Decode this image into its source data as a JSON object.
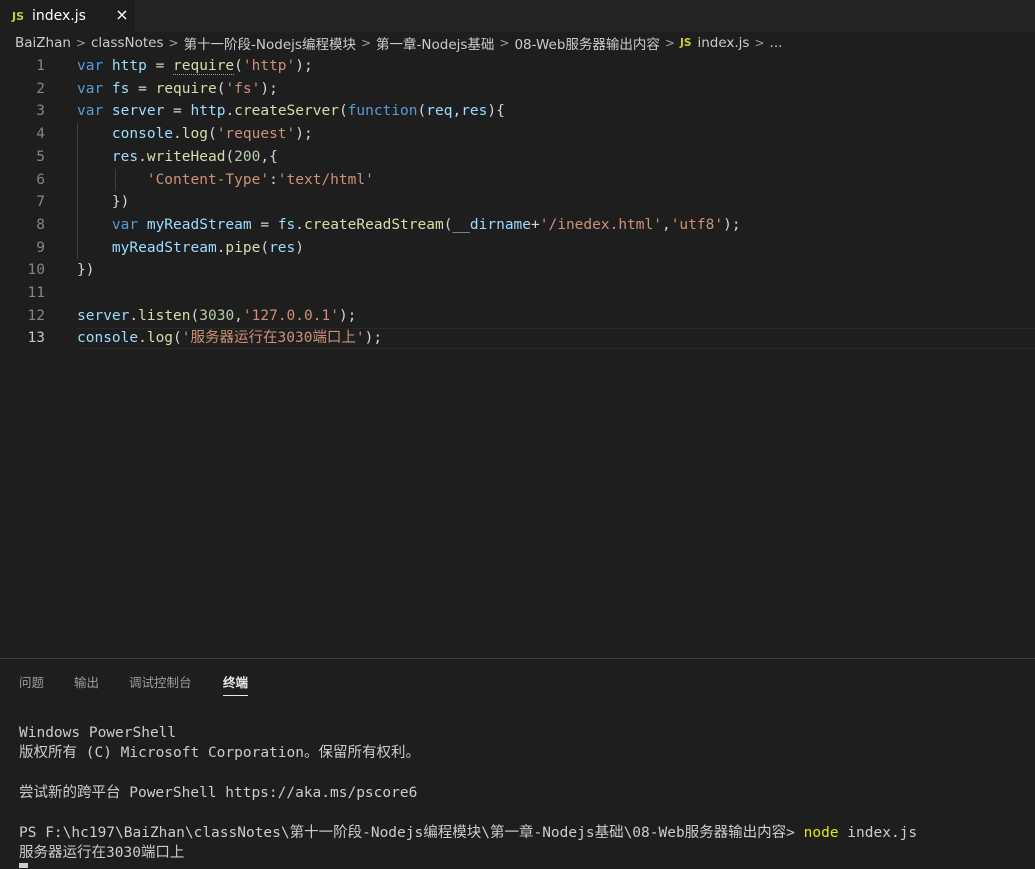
{
  "tab": {
    "badge": "JS",
    "label": "index.js",
    "close": "×"
  },
  "breadcrumb": {
    "items": [
      "BaiZhan",
      "classNotes",
      "第十一阶段-Nodejs编程模块",
      "第一章-Nodejs基础",
      "08-Web服务器输出内容"
    ],
    "file_badge": "JS",
    "file": "index.js",
    "more": "..."
  },
  "editor": {
    "lines": [
      {
        "n": "1",
        "t": [
          [
            "kw",
            "var "
          ],
          [
            "var",
            "http"
          ],
          [
            "punc",
            " = "
          ],
          [
            "fn sq",
            "require"
          ],
          [
            "punc",
            "("
          ],
          [
            "str",
            "'http'"
          ],
          [
            "punc",
            ");"
          ]
        ]
      },
      {
        "n": "2",
        "t": [
          [
            "kw",
            "var "
          ],
          [
            "var",
            "fs"
          ],
          [
            "punc",
            " = "
          ],
          [
            "fn",
            "require"
          ],
          [
            "punc",
            "("
          ],
          [
            "str",
            "'fs'"
          ],
          [
            "punc",
            ");"
          ]
        ]
      },
      {
        "n": "3",
        "t": [
          [
            "kw",
            "var "
          ],
          [
            "var",
            "server"
          ],
          [
            "punc",
            " = "
          ],
          [
            "var",
            "http"
          ],
          [
            "punc",
            "."
          ],
          [
            "fn",
            "createServer"
          ],
          [
            "punc",
            "("
          ],
          [
            "kw",
            "function"
          ],
          [
            "punc",
            "("
          ],
          [
            "var",
            "req"
          ],
          [
            "punc",
            ","
          ],
          [
            "var",
            "res"
          ],
          [
            "punc",
            "){"
          ]
        ]
      },
      {
        "n": "4",
        "t": [
          [
            "punc",
            "    "
          ],
          [
            "var",
            "console"
          ],
          [
            "punc",
            "."
          ],
          [
            "fn",
            "log"
          ],
          [
            "punc",
            "("
          ],
          [
            "str",
            "'request'"
          ],
          [
            "punc",
            ");"
          ]
        ]
      },
      {
        "n": "5",
        "t": [
          [
            "punc",
            "    "
          ],
          [
            "var",
            "res"
          ],
          [
            "punc",
            "."
          ],
          [
            "fn",
            "writeHead"
          ],
          [
            "punc",
            "("
          ],
          [
            "num",
            "200"
          ],
          [
            "punc",
            ",{"
          ]
        ]
      },
      {
        "n": "6",
        "t": [
          [
            "punc",
            "        "
          ],
          [
            "str",
            "'Content-Type'"
          ],
          [
            "punc",
            ":"
          ],
          [
            "str",
            "'text/html'"
          ]
        ]
      },
      {
        "n": "7",
        "t": [
          [
            "punc",
            "    })"
          ]
        ]
      },
      {
        "n": "8",
        "t": [
          [
            "punc",
            "    "
          ],
          [
            "kw",
            "var "
          ],
          [
            "var",
            "myReadStream"
          ],
          [
            "punc",
            " = "
          ],
          [
            "var",
            "fs"
          ],
          [
            "punc",
            "."
          ],
          [
            "fn",
            "createReadStream"
          ],
          [
            "punc",
            "("
          ],
          [
            "var",
            "__dirname"
          ],
          [
            "punc",
            "+"
          ],
          [
            "str",
            "'/inedex.html'"
          ],
          [
            "punc",
            ","
          ],
          [
            "str",
            "'utf8'"
          ],
          [
            "punc",
            ");"
          ]
        ]
      },
      {
        "n": "9",
        "t": [
          [
            "punc",
            "    "
          ],
          [
            "var",
            "myReadStream"
          ],
          [
            "punc",
            "."
          ],
          [
            "fn",
            "pipe"
          ],
          [
            "punc",
            "("
          ],
          [
            "var",
            "res"
          ],
          [
            "punc",
            ")"
          ]
        ]
      },
      {
        "n": "10",
        "t": [
          [
            "punc",
            "})"
          ]
        ]
      },
      {
        "n": "11",
        "t": []
      },
      {
        "n": "12",
        "t": [
          [
            "var",
            "server"
          ],
          [
            "punc",
            "."
          ],
          [
            "fn",
            "listen"
          ],
          [
            "punc",
            "("
          ],
          [
            "num",
            "3030"
          ],
          [
            "punc",
            ","
          ],
          [
            "str",
            "'127.0.0.1'"
          ],
          [
            "punc",
            ");"
          ]
        ]
      },
      {
        "n": "13",
        "t": [
          [
            "var",
            "console"
          ],
          [
            "punc",
            "."
          ],
          [
            "fn",
            "log"
          ],
          [
            "punc",
            "("
          ],
          [
            "str",
            "'服务器运行在3030端口上'"
          ],
          [
            "punc",
            ");"
          ]
        ]
      }
    ],
    "active_line": "13"
  },
  "panel": {
    "tabs": [
      "问题",
      "输出",
      "调试控制台",
      "终端"
    ],
    "active_tab": "终端",
    "terminal": {
      "line1": "Windows PowerShell",
      "line2": "版权所有 (C) Microsoft Corporation。保留所有权利。",
      "line3": "尝试新的跨平台 PowerShell https://aka.ms/pscore6",
      "prompt": "PS F:\\hc197\\BaiZhan\\classNotes\\第十一阶段-Nodejs编程模块\\第一章-Nodejs基础\\08-Web服务器输出内容> ",
      "command": "node",
      "command_arg": " index.js",
      "output": "服务器运行在3030端口上"
    }
  }
}
